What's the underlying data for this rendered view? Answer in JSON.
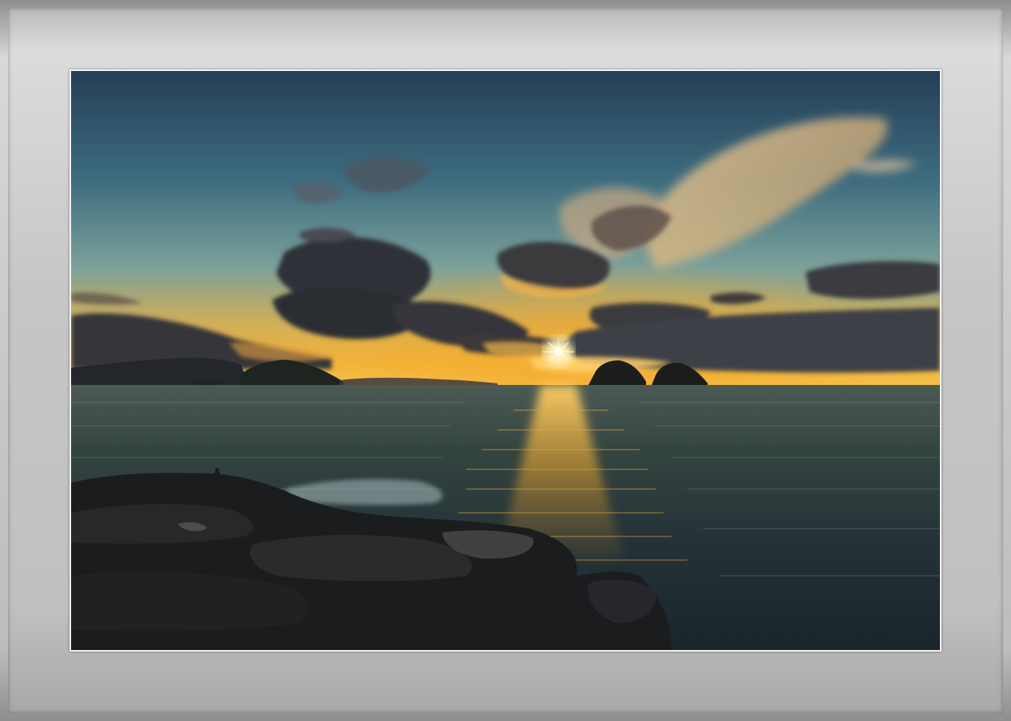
{
  "image": {
    "subject": "sea-sunset",
    "colors": {
      "sky_top": "#2b4a62",
      "sky_mid": "#5f8e98",
      "sky_horizon": "#f0b43c",
      "sun": "#fff6c8",
      "sea_dark": "#1d2a30",
      "sea_glint": "#d9a030",
      "rock": "#1a1b1d",
      "cloud_dark": "#3a3c44",
      "mat": "#c8c8c8",
      "border": "#f4f4f4"
    }
  }
}
